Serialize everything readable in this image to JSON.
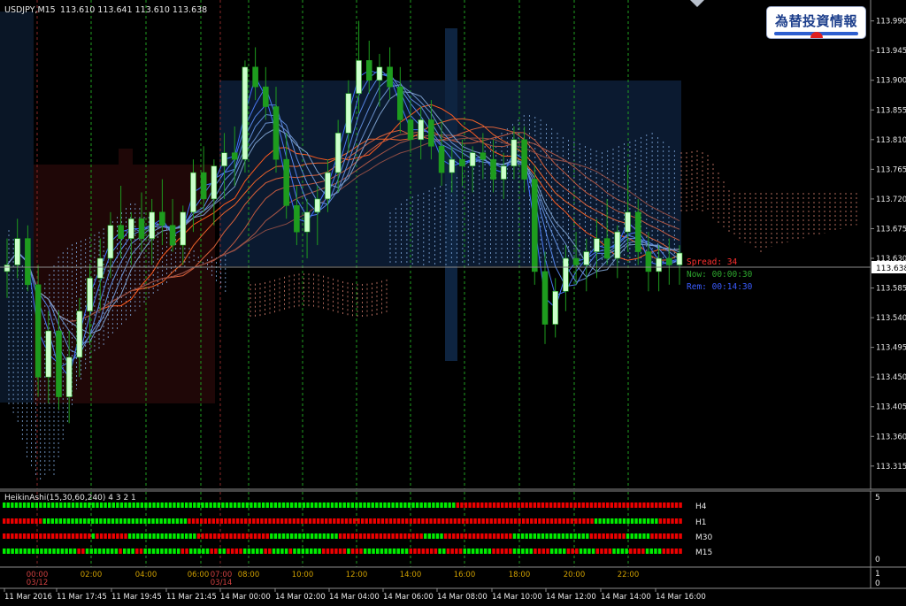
{
  "header": {
    "symbol": "USDJPY,M15",
    "ohlc": "113.610 113.641 113.610 113.638"
  },
  "logo": {
    "text": "為替投資情報"
  },
  "info": {
    "spread": "Spread: 34",
    "now": "Now: 00:00:30",
    "rem": "Rem: 00:14:30"
  },
  "price_axis": {
    "labels": [
      "113.990",
      "113.945",
      "113.900",
      "113.855",
      "113.810",
      "113.765",
      "113.720",
      "113.675",
      "113.630",
      "113.585",
      "113.540",
      "113.495",
      "113.450",
      "113.405",
      "113.360",
      "113.315"
    ],
    "current": "113.638"
  },
  "subwindow": {
    "title": "HeikinAshi(15,30,60,240) 4 3 2 1",
    "rows": [
      {
        "label": "H4",
        "pattern": "ggggggggggggggggggggggggggggggggggggggggggggggggggggggggggggggggggggggggggggggggggggggggggggggggggggggggggggggggrrrrrrrrrrrrrrrrrrrrrrrrrrrrrrrrrrrrrrrrrrrrrrrrrrrrrrrr"
      },
      {
        "label": "H1",
        "pattern": "rrrrrrrrrrggggggggggggggggggggggggggggggggggggrrrrrrrrrrrrrrrrrrrrrrrrrrrrrrrrrrrrrrrrrrrrrrrrrrrrrrrrrrrrrrrrrrrrrrrrrrrrrrrrrrrrrrrrrrrrrrrrrrrrrggggggggggggggggrrrrrr"
      },
      {
        "label": "M30",
        "pattern": "rrrrrrrrrrrrrrrrrrrrrrgrrrrrrrrgggggggggggggggggrrrrrrrrrrrrrrrrrrgggggggggggggggggrrrrrrrrrrrrrrrrrrrrrgggggrrrrrrrrrrrrrrrrrgggggggggggggggggggrrrrrrrrrggggggrrrrrrrr"
      },
      {
        "label": "M15",
        "pattern": "ggggggggggggggggggrrggggggggrgggrrgggggggggrrgggggrrggrrrrgggggrrggggrgggggggrrrrrrgrrrgggggggggggrrrrrrrggrrrrgggggggrrrrrgggggrrrrggggrrrggggrrrrggggrrrrggggrrrrr"
      }
    ],
    "scale_top": "5",
    "scale_bottom": "0"
  },
  "bottom_axis": {
    "top": "1",
    "bottom": "0"
  },
  "time_labels": [
    {
      "text": "11 Mar 2016"
    },
    {
      "text": "11 Mar 17:45"
    },
    {
      "text": "11 Mar 19:45"
    },
    {
      "text": "11 Mar 21:45"
    },
    {
      "text": "14 Mar 00:00"
    },
    {
      "text": "14 Mar 02:00"
    },
    {
      "text": "14 Mar 04:00"
    },
    {
      "text": "14 Mar 06:00"
    },
    {
      "text": "14 Mar 08:00"
    },
    {
      "text": "14 Mar 10:00"
    },
    {
      "text": "14 Mar 12:00"
    },
    {
      "text": "14 Mar 14:00"
    },
    {
      "text": "14 Mar 16:00"
    }
  ],
  "session_labels": [
    {
      "time": "00:00",
      "date": "03/12",
      "color": "#d04040"
    },
    {
      "time": "02:00",
      "date": "",
      "color": "#d0a000"
    },
    {
      "time": "04:00",
      "date": "",
      "color": "#d0a000"
    },
    {
      "time": "06:00",
      "date": "",
      "color": "#d0a000"
    },
    {
      "time": "07:00",
      "date": "03/14",
      "color": "#d04040"
    },
    {
      "time": "08:00",
      "date": "",
      "color": "#d0a000"
    },
    {
      "time": "10:00",
      "date": "",
      "color": "#d0a000"
    },
    {
      "time": "12:00",
      "date": "",
      "color": "#d0a000"
    },
    {
      "time": "14:00",
      "date": "",
      "color": "#d0a000"
    },
    {
      "time": "16:00",
      "date": "",
      "color": "#d0a000"
    },
    {
      "time": "18:00",
      "date": "",
      "color": "#d0a000"
    },
    {
      "time": "20:00",
      "date": "",
      "color": "#d0a000"
    },
    {
      "time": "22:00",
      "date": "",
      "color": "#d0a000"
    }
  ],
  "colors": {
    "bg": "#000000",
    "bull": "#ccffcc",
    "bear": "#1e9c1e",
    "dot_green": "#00ee00",
    "dot_red": "#ee0000",
    "grid_green": "#1fa01f",
    "grid_red": "#8a2828",
    "spread": "#ff3030",
    "now": "#2ea82e",
    "rem": "#3a5bff"
  },
  "chart_data": {
    "type": "candlestick",
    "symbol": "USDJPY",
    "timeframe": "M15",
    "ylim": [
      113.3,
      114.015
    ],
    "last": 113.638,
    "candles": [
      [
        113.61,
        113.66,
        113.57,
        113.62
      ],
      [
        113.62,
        113.69,
        113.6,
        113.66
      ],
      [
        113.66,
        113.68,
        113.58,
        113.59
      ],
      [
        113.59,
        113.62,
        113.42,
        113.45
      ],
      [
        113.45,
        113.55,
        113.41,
        113.52
      ],
      [
        113.52,
        113.55,
        113.4,
        113.42
      ],
      [
        113.42,
        113.52,
        113.38,
        113.48
      ],
      [
        113.48,
        113.57,
        113.45,
        113.55
      ],
      [
        113.55,
        113.62,
        113.5,
        113.6
      ],
      [
        113.6,
        113.66,
        113.55,
        113.63
      ],
      [
        113.63,
        113.7,
        113.6,
        113.68
      ],
      [
        113.68,
        113.74,
        113.63,
        113.66
      ],
      [
        113.66,
        113.7,
        113.62,
        113.69
      ],
      [
        113.69,
        113.73,
        113.64,
        113.66
      ],
      [
        113.66,
        113.72,
        113.62,
        113.7
      ],
      [
        113.7,
        113.75,
        113.65,
        113.68
      ],
      [
        113.68,
        113.72,
        113.64,
        113.65
      ],
      [
        113.65,
        113.71,
        113.62,
        113.7
      ],
      [
        113.7,
        113.78,
        113.67,
        113.76
      ],
      [
        113.76,
        113.8,
        113.7,
        113.72
      ],
      [
        113.72,
        113.78,
        113.68,
        113.77
      ],
      [
        113.77,
        113.82,
        113.72,
        113.79
      ],
      [
        113.79,
        113.83,
        113.74,
        113.78
      ],
      [
        113.78,
        113.93,
        113.76,
        113.92
      ],
      [
        113.92,
        113.95,
        113.87,
        113.89
      ],
      [
        113.89,
        113.92,
        113.84,
        113.86
      ],
      [
        113.86,
        113.89,
        113.76,
        113.78
      ],
      [
        113.78,
        113.82,
        113.69,
        113.71
      ],
      [
        113.71,
        113.74,
        113.65,
        113.67
      ],
      [
        113.67,
        113.72,
        113.63,
        113.7
      ],
      [
        113.7,
        113.74,
        113.65,
        113.72
      ],
      [
        113.72,
        113.78,
        113.7,
        113.76
      ],
      [
        113.76,
        113.84,
        113.73,
        113.82
      ],
      [
        113.82,
        113.9,
        113.79,
        113.88
      ],
      [
        113.88,
        113.99,
        113.85,
        113.93
      ],
      [
        113.93,
        113.96,
        113.88,
        113.9
      ],
      [
        113.9,
        113.94,
        113.86,
        113.92
      ],
      [
        113.92,
        113.95,
        113.87,
        113.89
      ],
      [
        113.89,
        113.92,
        113.82,
        113.84
      ],
      [
        113.84,
        113.87,
        113.79,
        113.81
      ],
      [
        113.81,
        113.86,
        113.78,
        113.84
      ],
      [
        113.84,
        113.87,
        113.78,
        113.8
      ],
      [
        113.8,
        113.84,
        113.74,
        113.76
      ],
      [
        113.76,
        113.8,
        113.73,
        113.78
      ],
      [
        113.78,
        113.81,
        113.74,
        113.77
      ],
      [
        113.77,
        113.8,
        113.73,
        113.79
      ],
      [
        113.79,
        113.82,
        113.75,
        113.78
      ],
      [
        113.78,
        113.81,
        113.73,
        113.75
      ],
      [
        113.75,
        113.79,
        113.72,
        113.77
      ],
      [
        113.77,
        113.83,
        113.75,
        113.81
      ],
      [
        113.81,
        113.83,
        113.73,
        113.75
      ],
      [
        113.75,
        113.77,
        113.59,
        113.61
      ],
      [
        113.61,
        113.64,
        113.5,
        113.53
      ],
      [
        113.53,
        113.6,
        113.51,
        113.58
      ],
      [
        113.58,
        113.65,
        113.55,
        113.63
      ],
      [
        113.63,
        113.67,
        113.59,
        113.62
      ],
      [
        113.62,
        113.66,
        113.58,
        113.64
      ],
      [
        113.64,
        113.69,
        113.6,
        113.66
      ],
      [
        113.66,
        113.72,
        113.62,
        113.63
      ],
      [
        113.63,
        113.68,
        113.6,
        113.67
      ],
      [
        113.67,
        113.77,
        113.64,
        113.7
      ],
      [
        113.7,
        113.72,
        113.62,
        113.64
      ],
      [
        113.64,
        113.67,
        113.58,
        113.61
      ],
      [
        113.61,
        113.65,
        113.58,
        113.63
      ],
      [
        113.63,
        113.66,
        113.59,
        113.62
      ],
      [
        113.62,
        113.65,
        113.59,
        113.638
      ]
    ]
  }
}
